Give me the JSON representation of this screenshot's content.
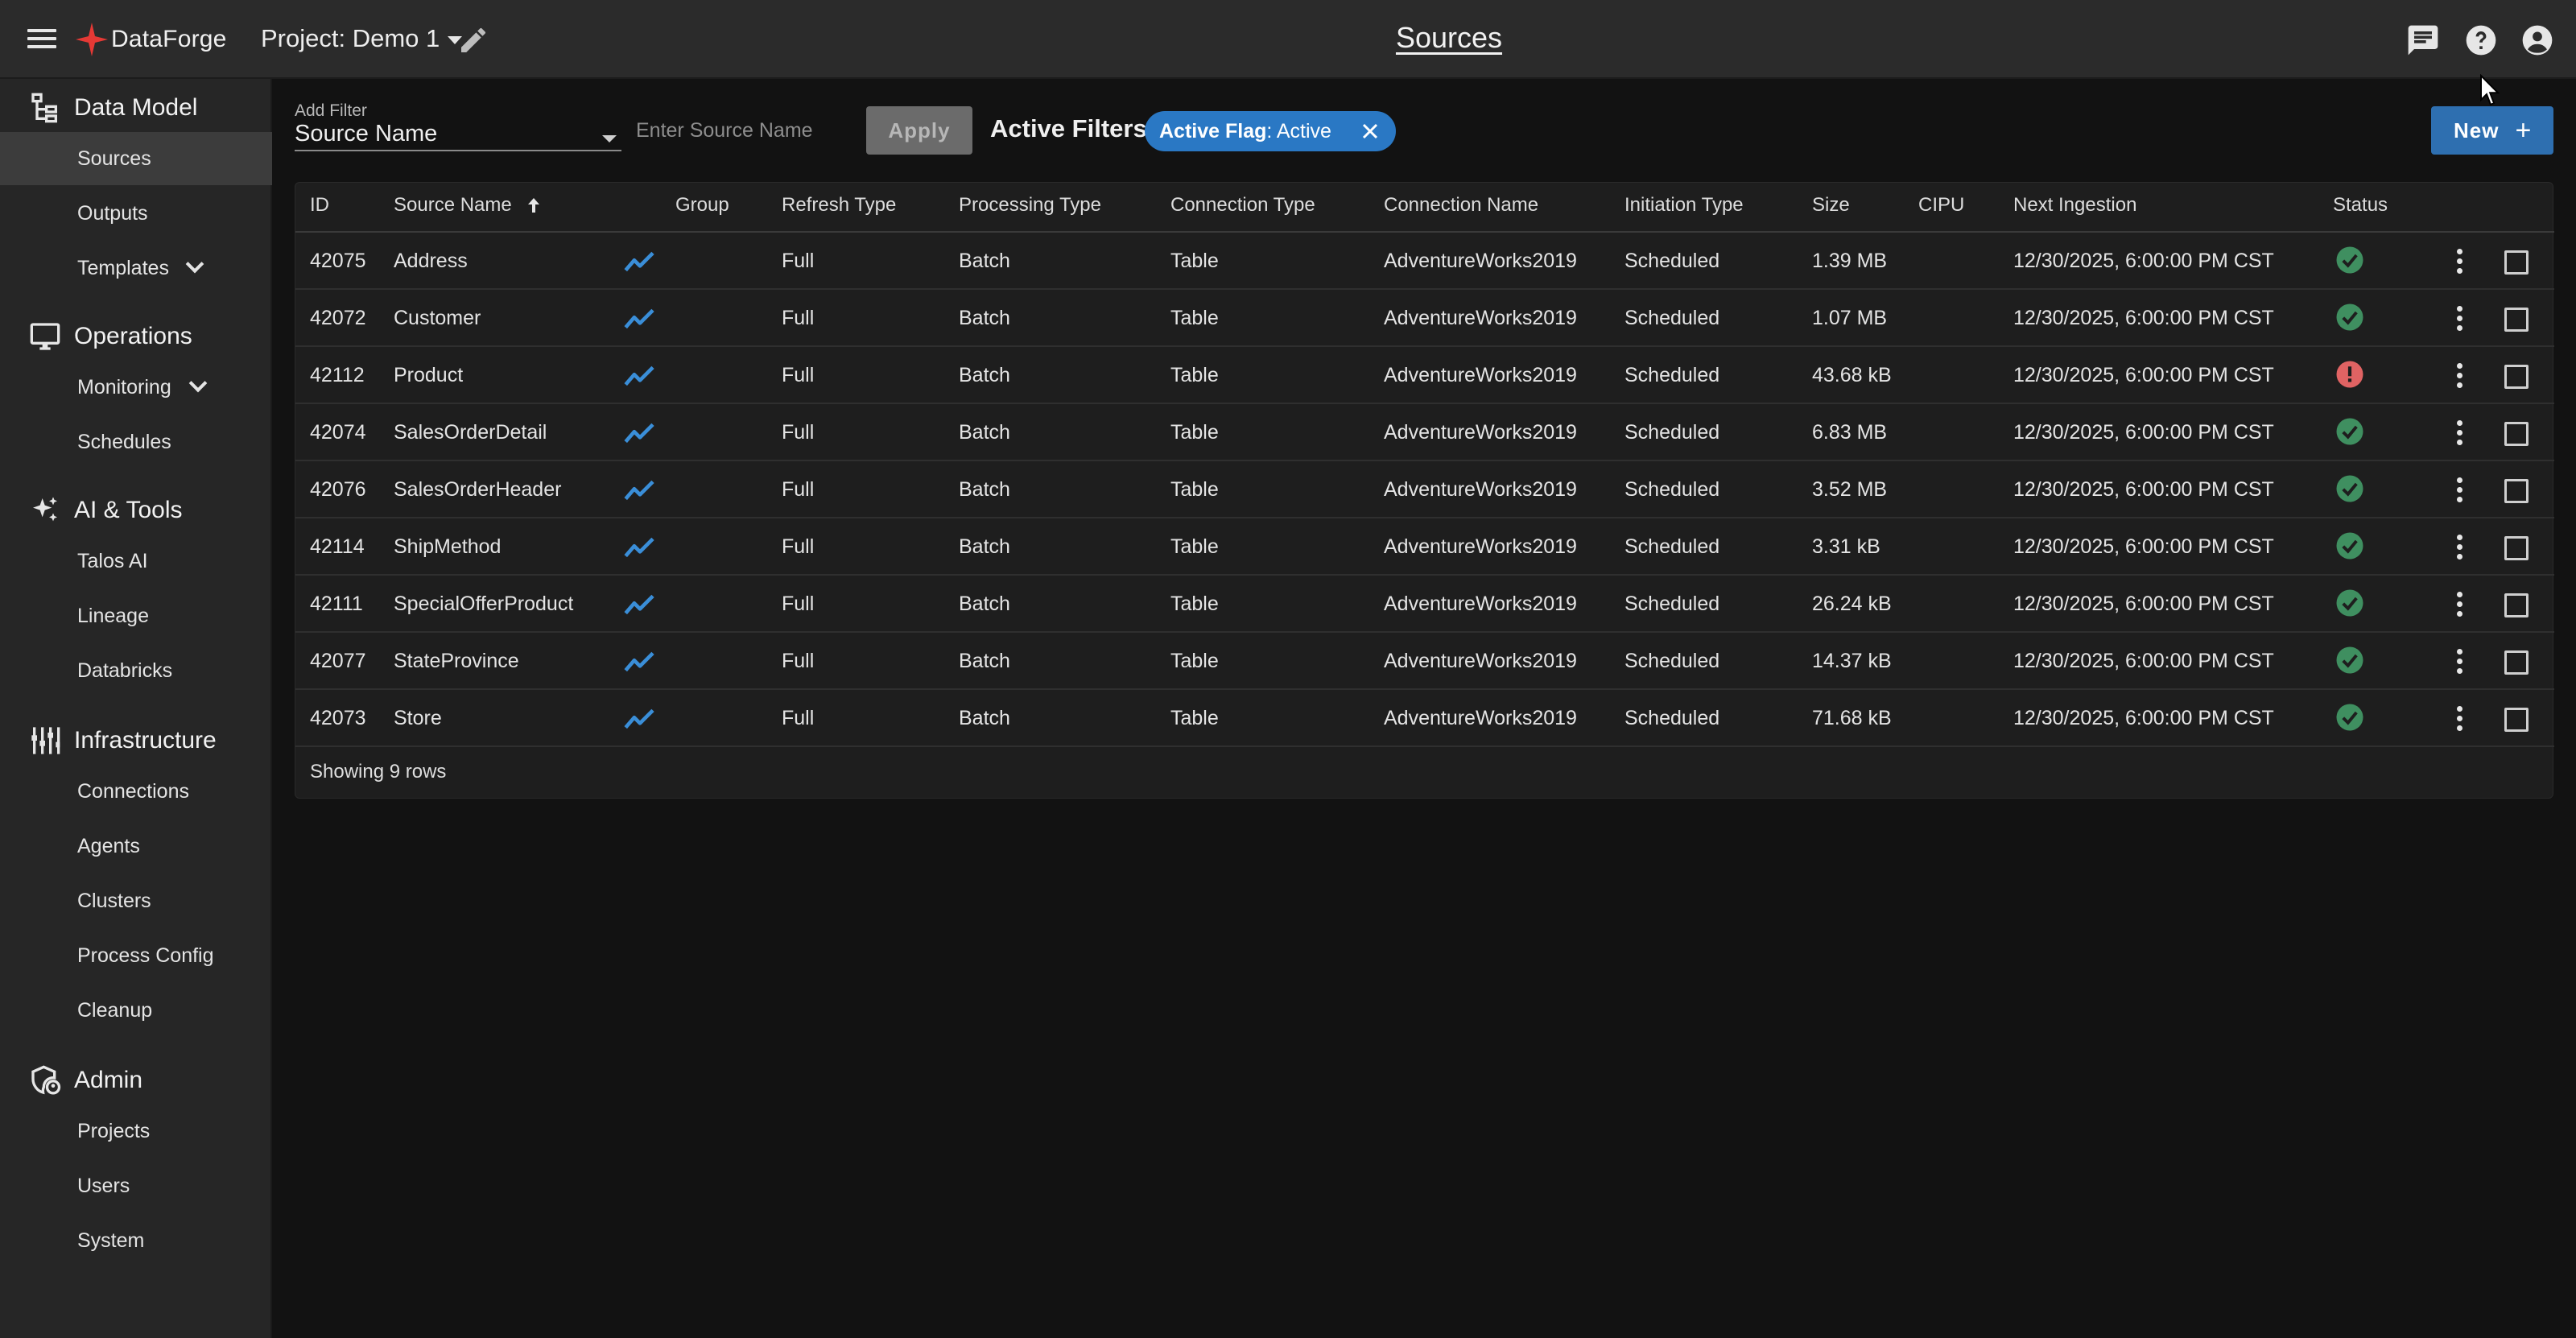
{
  "app": {
    "name": "DataForge",
    "project_label": "Project: Demo 1",
    "page_title": "Sources"
  },
  "colors": {
    "accent": "#2e6fb0",
    "chip": "#2a78c4",
    "ok": "#3f8f60",
    "error": "#e06363",
    "brand_red": "#e53935"
  },
  "sidebar": {
    "sections": [
      {
        "label": "Data Model",
        "icon": "data-model-icon",
        "items": [
          {
            "label": "Sources",
            "active": true
          },
          {
            "label": "Outputs"
          },
          {
            "label": "Templates",
            "expandable": true
          }
        ]
      },
      {
        "label": "Operations",
        "icon": "monitor-icon",
        "items": [
          {
            "label": "Monitoring",
            "expandable": true
          },
          {
            "label": "Schedules"
          }
        ]
      },
      {
        "label": "AI & Tools",
        "icon": "sparkle-icon",
        "items": [
          {
            "label": "Talos AI"
          },
          {
            "label": "Lineage"
          },
          {
            "label": "Databricks"
          }
        ]
      },
      {
        "label": "Infrastructure",
        "icon": "infrastructure-icon",
        "items": [
          {
            "label": "Connections"
          },
          {
            "label": "Agents"
          },
          {
            "label": "Clusters"
          },
          {
            "label": "Process Config"
          },
          {
            "label": "Cleanup"
          }
        ]
      },
      {
        "label": "Admin",
        "icon": "admin-icon",
        "items": [
          {
            "label": "Projects"
          },
          {
            "label": "Users"
          },
          {
            "label": "System"
          }
        ]
      }
    ]
  },
  "filter": {
    "add_label": "Add Filter",
    "field_value": "Source Name",
    "placeholder": "Enter Source Name",
    "apply_label": "Apply",
    "active_label": "Active Filters:",
    "chip_key": "Active Flag",
    "chip_value": ": Active"
  },
  "toolbar": {
    "new_label": "New",
    "new_icon": "plus-icon"
  },
  "table": {
    "columns": [
      "ID",
      "Source Name",
      "Group",
      "Refresh Type",
      "Processing Type",
      "Connection Type",
      "Connection Name",
      "Initiation Type",
      "Size",
      "CIPU",
      "Next Ingestion",
      "Status"
    ],
    "sort": {
      "column": "Source Name",
      "direction": "ascending"
    },
    "rows": [
      {
        "id": "42075",
        "name": "Address",
        "refresh": "Full",
        "processing": "Batch",
        "conn_type": "Table",
        "conn_name": "AdventureWorks2019",
        "initiation": "Scheduled",
        "size": "1.39 MB",
        "next": "12/30/2025, 6:00:00 PM CST",
        "status": "ok"
      },
      {
        "id": "42072",
        "name": "Customer",
        "refresh": "Full",
        "processing": "Batch",
        "conn_type": "Table",
        "conn_name": "AdventureWorks2019",
        "initiation": "Scheduled",
        "size": "1.07 MB",
        "next": "12/30/2025, 6:00:00 PM CST",
        "status": "ok"
      },
      {
        "id": "42112",
        "name": "Product",
        "refresh": "Full",
        "processing": "Batch",
        "conn_type": "Table",
        "conn_name": "AdventureWorks2019",
        "initiation": "Scheduled",
        "size": "43.68 kB",
        "next": "12/30/2025, 6:00:00 PM CST",
        "status": "error"
      },
      {
        "id": "42074",
        "name": "SalesOrderDetail",
        "refresh": "Full",
        "processing": "Batch",
        "conn_type": "Table",
        "conn_name": "AdventureWorks2019",
        "initiation": "Scheduled",
        "size": "6.83 MB",
        "next": "12/30/2025, 6:00:00 PM CST",
        "status": "ok"
      },
      {
        "id": "42076",
        "name": "SalesOrderHeader",
        "refresh": "Full",
        "processing": "Batch",
        "conn_type": "Table",
        "conn_name": "AdventureWorks2019",
        "initiation": "Scheduled",
        "size": "3.52 MB",
        "next": "12/30/2025, 6:00:00 PM CST",
        "status": "ok"
      },
      {
        "id": "42114",
        "name": "ShipMethod",
        "refresh": "Full",
        "processing": "Batch",
        "conn_type": "Table",
        "conn_name": "AdventureWorks2019",
        "initiation": "Scheduled",
        "size": "3.31 kB",
        "next": "12/30/2025, 6:00:00 PM CST",
        "status": "ok"
      },
      {
        "id": "42111",
        "name": "SpecialOfferProduct",
        "refresh": "Full",
        "processing": "Batch",
        "conn_type": "Table",
        "conn_name": "AdventureWorks2019",
        "initiation": "Scheduled",
        "size": "26.24 kB",
        "next": "12/30/2025, 6:00:00 PM CST",
        "status": "ok"
      },
      {
        "id": "42077",
        "name": "StateProvince",
        "refresh": "Full",
        "processing": "Batch",
        "conn_type": "Table",
        "conn_name": "AdventureWorks2019",
        "initiation": "Scheduled",
        "size": "14.37 kB",
        "next": "12/30/2025, 6:00:00 PM CST",
        "status": "ok"
      },
      {
        "id": "42073",
        "name": "Store",
        "refresh": "Full",
        "processing": "Batch",
        "conn_type": "Table",
        "conn_name": "AdventureWorks2019",
        "initiation": "Scheduled",
        "size": "71.68 kB",
        "next": "12/30/2025, 6:00:00 PM CST",
        "status": "ok"
      }
    ],
    "footer": "Showing 9 rows"
  }
}
